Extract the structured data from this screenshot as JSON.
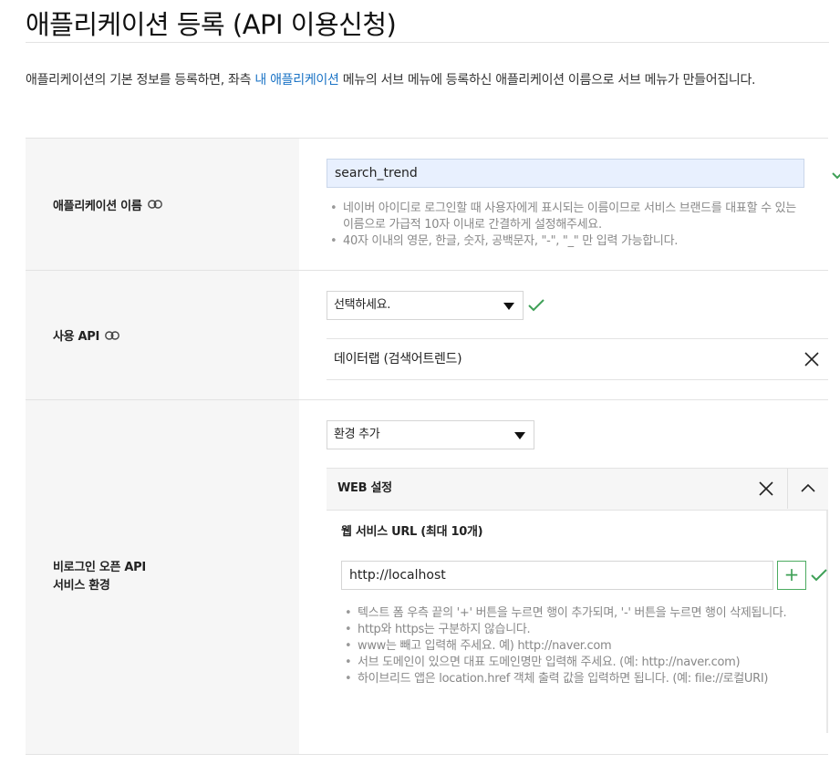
{
  "header": {
    "title": "애플리케이션 등록 (API 이용신청)"
  },
  "intro": {
    "text_before": "애플리케이션의 기본 정보를 등록하면, 좌측 ",
    "link": "내 애플리케이션",
    "text_after": " 메뉴의 서브 메뉴에 등록하신 애플리케이션 이름으로 서브 메뉴가 만들어집니다."
  },
  "app_name": {
    "label": "애플리케이션 이름",
    "value": "search_trend",
    "help": [
      "네이버 아이디로 로그인할 때 사용자에게 표시되는 이름이므로 서비스 브랜드를 대표할 수 있는 이름으로 가급적 10자 이내로 간결하게 설정해주세요.",
      "40자 이내의 영문, 한글, 숫자, 공백문자, \"-\", \"_\" 만 입력 가능합니다."
    ]
  },
  "api": {
    "label": "사용 API",
    "select_value": "선택하세요.",
    "selected_item": "데이터랩 (검색어트렌드)"
  },
  "env": {
    "label_line1": "비로그인 오픈 API",
    "label_line2": "서비스 환경",
    "select_value": "환경 추가",
    "web": {
      "title": "WEB 설정",
      "subtitle": "웹 서비스 URL (최대 10개)",
      "url_value": "http://localhost",
      "help": [
        "텍스트 폼 우측 끝의 '+' 버튼을 누르면 행이 추가되며, '-' 버튼을 누르면 행이 삭제됩니다.",
        "http와 https는 구분하지 않습니다.",
        "www는 빼고 입력해 주세요. 예) http://naver.com",
        "서브 도메인이 있으면 대표 도메인명만 입력해 주세요. (예: http://naver.com)",
        "하이브리드 앱은 location.href 객체 출력 값을 입력하면 됩니다. (예: file://로컬URI)"
      ]
    }
  },
  "colors": {
    "link": "#1a73c5",
    "check": "#3fa057",
    "input_fill": "#e8f0fe"
  },
  "icons": [
    "link-icon",
    "check-icon",
    "dropdown-arrow-icon",
    "close-icon",
    "chevron-up-icon",
    "plus-icon"
  ]
}
